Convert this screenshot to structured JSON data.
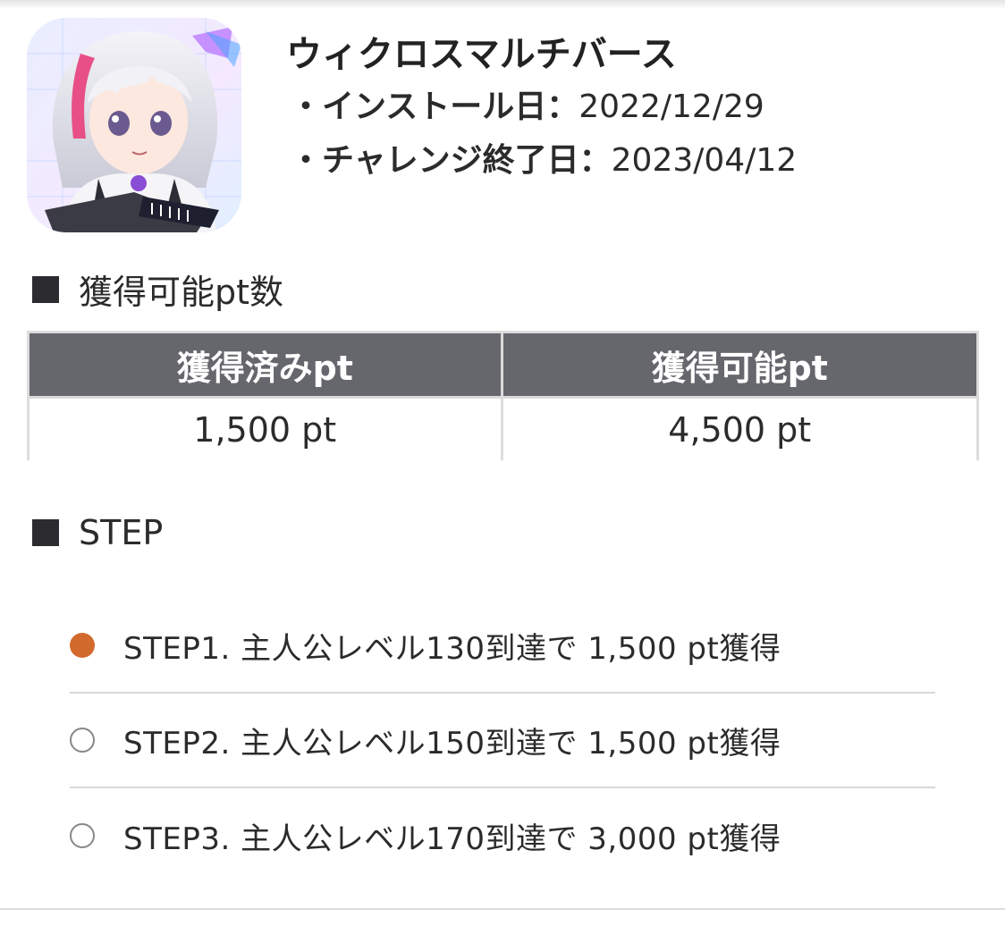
{
  "app": {
    "name": "ウィクロスマルチバース",
    "install_label": "・インストール日：",
    "install_date": "2022/12/29",
    "challenge_label": "・チャレンジ終了日：",
    "challenge_end": "2023/04/12"
  },
  "points_section": {
    "heading": "獲得可能pt数",
    "headers": [
      "獲得済みpt",
      "獲得可能pt"
    ],
    "values": [
      "1,500 pt",
      "4,500 pt"
    ]
  },
  "step_section": {
    "heading": "STEP",
    "steps": [
      {
        "text": "STEP1. 主人公レベル130到達で 1,500 pt獲得",
        "completed": true
      },
      {
        "text": "STEP2. 主人公レベル150到達で 1,500 pt獲得",
        "completed": false
      },
      {
        "text": "STEP3. 主人公レベル170到達で 3,000 pt獲得",
        "completed": false
      }
    ]
  },
  "colors": {
    "table_header_bg": "#66666d",
    "step_done": "#d26a2e",
    "step_todo_ring": "#888888"
  },
  "icons": {
    "app": "app-icon",
    "section_marker": "square-bullet-icon",
    "step_done": "filled-circle-icon",
    "step_todo": "empty-circle-icon"
  }
}
